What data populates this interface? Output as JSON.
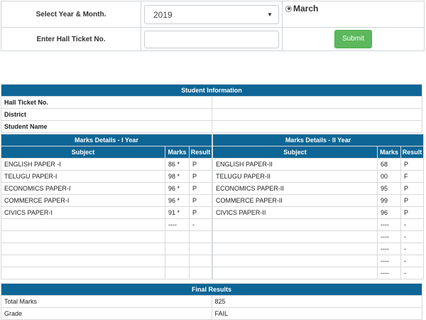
{
  "form": {
    "year_month_label": "Select Year & Month.",
    "year_value": "2019",
    "month_radio_label": "March",
    "hall_ticket_label": "Enter Hall Ticket No.",
    "hall_ticket_value": "",
    "submit_label": "Submit"
  },
  "student_info": {
    "heading": "Student Information",
    "rows": [
      {
        "key": "Hall Ticket No.",
        "value": ""
      },
      {
        "key": "District",
        "value": ""
      },
      {
        "key": "Student Name",
        "value": ""
      }
    ]
  },
  "marks_year1": {
    "heading": "Marks Details - I Year",
    "col_subject": "Subject",
    "col_marks": "Marks",
    "col_result": "Result",
    "rows": [
      {
        "subject": "ENGLISH PAPER -I",
        "marks": "86 *",
        "result": "P"
      },
      {
        "subject": "TELUGU PAPER-I",
        "marks": "98 *",
        "result": "P"
      },
      {
        "subject": "ECONOMICS PAPER-I",
        "marks": "96 *",
        "result": "P"
      },
      {
        "subject": "COMMERCE PAPER-I",
        "marks": "96 *",
        "result": "P"
      },
      {
        "subject": "CIVICS PAPER-I",
        "marks": "91 *",
        "result": "P"
      },
      {
        "subject": "",
        "marks": "----",
        "result": "-"
      },
      {
        "subject": "",
        "marks": "",
        "result": ""
      },
      {
        "subject": "",
        "marks": "",
        "result": ""
      },
      {
        "subject": "",
        "marks": "",
        "result": ""
      },
      {
        "subject": "",
        "marks": "",
        "result": ""
      }
    ]
  },
  "marks_year2": {
    "heading": "Marks Details - II Year",
    "col_subject": "Subject",
    "col_marks": "Marks",
    "col_result": "Result",
    "rows": [
      {
        "subject": "ENGLISH PAPER-II",
        "marks": "68",
        "result": "P"
      },
      {
        "subject": "TELUGU PAPER-II",
        "marks": "00",
        "result": "F"
      },
      {
        "subject": "ECONOMICS PAPER-II",
        "marks": "95",
        "result": "P"
      },
      {
        "subject": "COMMERCE PAPER-II",
        "marks": "99",
        "result": "P"
      },
      {
        "subject": "CIVICS PAPER-II",
        "marks": "96",
        "result": "P"
      },
      {
        "subject": "",
        "marks": "----",
        "result": "-"
      },
      {
        "subject": "",
        "marks": "----",
        "result": "-"
      },
      {
        "subject": "",
        "marks": "----",
        "result": "-"
      },
      {
        "subject": "",
        "marks": "----",
        "result": "-"
      },
      {
        "subject": "",
        "marks": "----",
        "result": "-"
      }
    ]
  },
  "final_results": {
    "heading": "Final Results",
    "rows": [
      {
        "key": "Total Marks",
        "value": "825"
      },
      {
        "key": "Grade",
        "value": "FAIL"
      }
    ]
  },
  "colors": {
    "header_blue": "#0d6696",
    "submit_green": "#5cb85c",
    "border": "#d6d9dc"
  }
}
